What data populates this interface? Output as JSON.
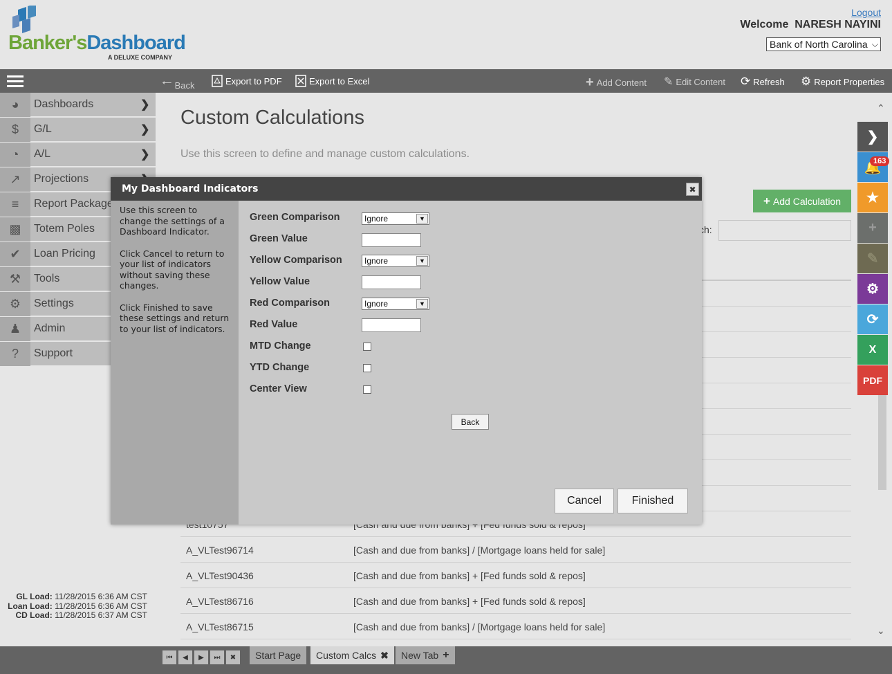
{
  "header": {
    "logo_brand_1": "Banker's",
    "logo_brand_2": "Dashboard",
    "logo_tagline": "A DELUXE COMPANY",
    "logout": "Logout",
    "welcome_prefix": "Welcome",
    "user_name": "NARESH NAYINI",
    "bank_selected": "Bank of North Carolina"
  },
  "toolbar": {
    "back": "Back",
    "export_pdf": "Export to PDF",
    "export_excel": "Export to Excel",
    "add_content": "Add Content",
    "edit_content": "Edit Content",
    "refresh": "Refresh",
    "report_properties": "Report Properties"
  },
  "sidebar": {
    "items": [
      {
        "label": "Dashboards",
        "icon": "compass-icon"
      },
      {
        "label": "G/L",
        "icon": "dollar-icon"
      },
      {
        "label": "A/L",
        "icon": "pie-chart-icon"
      },
      {
        "label": "Projections",
        "icon": "line-chart-icon"
      },
      {
        "label": "Report Packages",
        "icon": "layers-icon"
      },
      {
        "label": "Totem Poles",
        "icon": "bar-chart-icon"
      },
      {
        "label": "Loan Pricing",
        "icon": "checkmark-icon"
      },
      {
        "label": "Tools",
        "icon": "hammer-icon"
      },
      {
        "label": "Settings",
        "icon": "gear-icon"
      },
      {
        "label": "Admin",
        "icon": "user-icon"
      },
      {
        "label": "Support",
        "icon": "question-icon"
      }
    ],
    "load_info": {
      "gl_label": "GL Load:",
      "gl_value": "11/28/2015 6:36 AM CST",
      "loan_label": "Loan Load:",
      "loan_value": "11/28/2015 6:36 AM CST",
      "cd_label": "CD Load:",
      "cd_value": "11/28/2015 6:37 AM CST"
    }
  },
  "main": {
    "title": "Custom Calculations",
    "description": "Use this screen to define and manage custom calculations.",
    "add_calculation": "Add Calculation",
    "search_label": "ch:",
    "rows": [
      {
        "name": "test10757",
        "formula": "[Cash and due from banks] + [Fed funds sold & repos]"
      },
      {
        "name": "A_VLTest96714",
        "formula": "[Cash and due from banks] / [Mortgage loans held for sale]"
      },
      {
        "name": "A_VLTest90436",
        "formula": "[Cash and due from banks] + [Fed funds sold & repos]"
      },
      {
        "name": "A_VLTest86716",
        "formula": "[Cash and due from banks] + [Fed funds sold & repos]"
      },
      {
        "name": "A_VLTest86715",
        "formula": "[Cash and due from banks] / [Mortgage loans held for sale]"
      }
    ]
  },
  "rail": {
    "notification_count": "163"
  },
  "tabs": {
    "items": [
      {
        "label": "Start Page"
      },
      {
        "label": "Custom Calcs"
      },
      {
        "label": "New Tab"
      }
    ]
  },
  "modal": {
    "title": "My Dashboard Indicators",
    "help": [
      "Use this screen to change the settings of a Dashboard Indicator.",
      "Click Cancel to return to your list of indicators without saving these changes.",
      "Click Finished to save these settings and return to your list of indicators."
    ],
    "fields": {
      "green_comparison": {
        "label": "Green Comparison",
        "value": "Ignore"
      },
      "green_value": {
        "label": "Green Value",
        "value": ""
      },
      "yellow_comparison": {
        "label": "Yellow Comparison",
        "value": "Ignore"
      },
      "yellow_value": {
        "label": "Yellow Value",
        "value": ""
      },
      "red_comparison": {
        "label": "Red Comparison",
        "value": "Ignore"
      },
      "red_value": {
        "label": "Red Value",
        "value": ""
      },
      "mtd_change": {
        "label": "MTD Change",
        "checked": false
      },
      "ytd_change": {
        "label": "YTD Change",
        "checked": false
      },
      "center_view": {
        "label": "Center View",
        "checked": false
      }
    },
    "back": "Back",
    "cancel": "Cancel",
    "finished": "Finished"
  }
}
